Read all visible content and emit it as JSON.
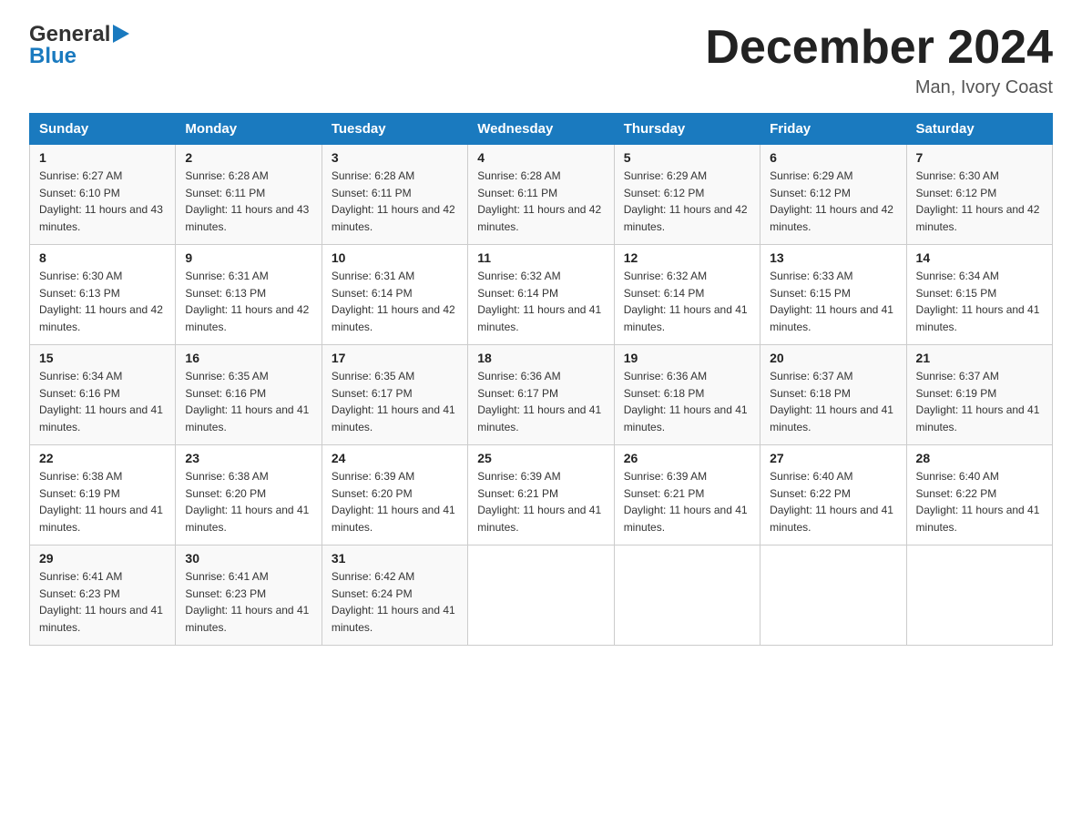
{
  "header": {
    "logo_general": "General",
    "logo_blue": "Blue",
    "month_title": "December 2024",
    "location": "Man, Ivory Coast"
  },
  "days_of_week": [
    "Sunday",
    "Monday",
    "Tuesday",
    "Wednesday",
    "Thursday",
    "Friday",
    "Saturday"
  ],
  "weeks": [
    [
      {
        "day": "1",
        "sunrise": "6:27 AM",
        "sunset": "6:10 PM",
        "daylight": "11 hours and 43 minutes."
      },
      {
        "day": "2",
        "sunrise": "6:28 AM",
        "sunset": "6:11 PM",
        "daylight": "11 hours and 43 minutes."
      },
      {
        "day": "3",
        "sunrise": "6:28 AM",
        "sunset": "6:11 PM",
        "daylight": "11 hours and 42 minutes."
      },
      {
        "day": "4",
        "sunrise": "6:28 AM",
        "sunset": "6:11 PM",
        "daylight": "11 hours and 42 minutes."
      },
      {
        "day": "5",
        "sunrise": "6:29 AM",
        "sunset": "6:12 PM",
        "daylight": "11 hours and 42 minutes."
      },
      {
        "day": "6",
        "sunrise": "6:29 AM",
        "sunset": "6:12 PM",
        "daylight": "11 hours and 42 minutes."
      },
      {
        "day": "7",
        "sunrise": "6:30 AM",
        "sunset": "6:12 PM",
        "daylight": "11 hours and 42 minutes."
      }
    ],
    [
      {
        "day": "8",
        "sunrise": "6:30 AM",
        "sunset": "6:13 PM",
        "daylight": "11 hours and 42 minutes."
      },
      {
        "day": "9",
        "sunrise": "6:31 AM",
        "sunset": "6:13 PM",
        "daylight": "11 hours and 42 minutes."
      },
      {
        "day": "10",
        "sunrise": "6:31 AM",
        "sunset": "6:14 PM",
        "daylight": "11 hours and 42 minutes."
      },
      {
        "day": "11",
        "sunrise": "6:32 AM",
        "sunset": "6:14 PM",
        "daylight": "11 hours and 41 minutes."
      },
      {
        "day": "12",
        "sunrise": "6:32 AM",
        "sunset": "6:14 PM",
        "daylight": "11 hours and 41 minutes."
      },
      {
        "day": "13",
        "sunrise": "6:33 AM",
        "sunset": "6:15 PM",
        "daylight": "11 hours and 41 minutes."
      },
      {
        "day": "14",
        "sunrise": "6:34 AM",
        "sunset": "6:15 PM",
        "daylight": "11 hours and 41 minutes."
      }
    ],
    [
      {
        "day": "15",
        "sunrise": "6:34 AM",
        "sunset": "6:16 PM",
        "daylight": "11 hours and 41 minutes."
      },
      {
        "day": "16",
        "sunrise": "6:35 AM",
        "sunset": "6:16 PM",
        "daylight": "11 hours and 41 minutes."
      },
      {
        "day": "17",
        "sunrise": "6:35 AM",
        "sunset": "6:17 PM",
        "daylight": "11 hours and 41 minutes."
      },
      {
        "day": "18",
        "sunrise": "6:36 AM",
        "sunset": "6:17 PM",
        "daylight": "11 hours and 41 minutes."
      },
      {
        "day": "19",
        "sunrise": "6:36 AM",
        "sunset": "6:18 PM",
        "daylight": "11 hours and 41 minutes."
      },
      {
        "day": "20",
        "sunrise": "6:37 AM",
        "sunset": "6:18 PM",
        "daylight": "11 hours and 41 minutes."
      },
      {
        "day": "21",
        "sunrise": "6:37 AM",
        "sunset": "6:19 PM",
        "daylight": "11 hours and 41 minutes."
      }
    ],
    [
      {
        "day": "22",
        "sunrise": "6:38 AM",
        "sunset": "6:19 PM",
        "daylight": "11 hours and 41 minutes."
      },
      {
        "day": "23",
        "sunrise": "6:38 AM",
        "sunset": "6:20 PM",
        "daylight": "11 hours and 41 minutes."
      },
      {
        "day": "24",
        "sunrise": "6:39 AM",
        "sunset": "6:20 PM",
        "daylight": "11 hours and 41 minutes."
      },
      {
        "day": "25",
        "sunrise": "6:39 AM",
        "sunset": "6:21 PM",
        "daylight": "11 hours and 41 minutes."
      },
      {
        "day": "26",
        "sunrise": "6:39 AM",
        "sunset": "6:21 PM",
        "daylight": "11 hours and 41 minutes."
      },
      {
        "day": "27",
        "sunrise": "6:40 AM",
        "sunset": "6:22 PM",
        "daylight": "11 hours and 41 minutes."
      },
      {
        "day": "28",
        "sunrise": "6:40 AM",
        "sunset": "6:22 PM",
        "daylight": "11 hours and 41 minutes."
      }
    ],
    [
      {
        "day": "29",
        "sunrise": "6:41 AM",
        "sunset": "6:23 PM",
        "daylight": "11 hours and 41 minutes."
      },
      {
        "day": "30",
        "sunrise": "6:41 AM",
        "sunset": "6:23 PM",
        "daylight": "11 hours and 41 minutes."
      },
      {
        "day": "31",
        "sunrise": "6:42 AM",
        "sunset": "6:24 PM",
        "daylight": "11 hours and 41 minutes."
      },
      null,
      null,
      null,
      null
    ]
  ]
}
